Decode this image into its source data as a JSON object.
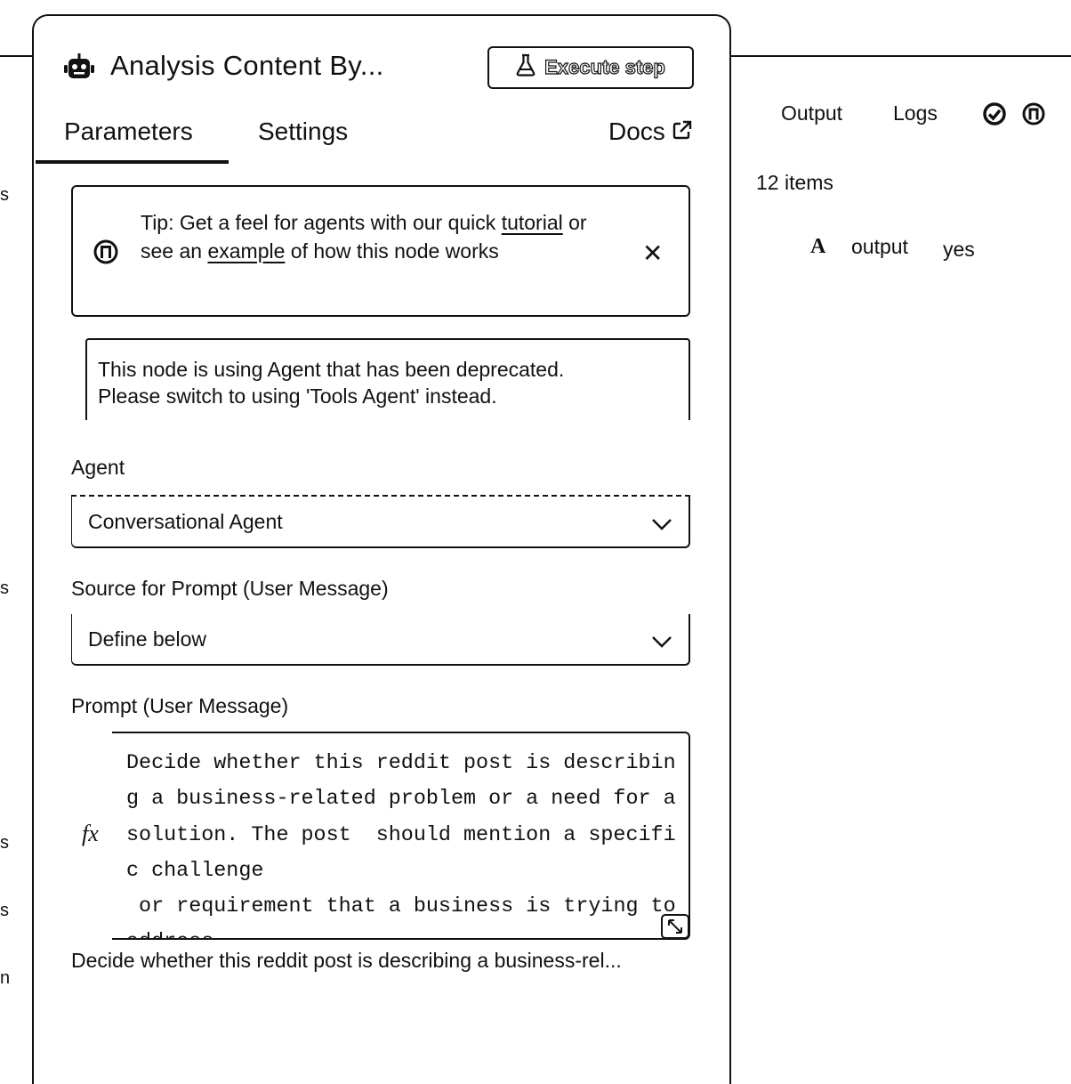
{
  "node": {
    "title": "Analysis Content  By...",
    "icon": "robot-icon",
    "execute_label": "Execute step"
  },
  "tabs": {
    "parameters": "Parameters",
    "settings": "Settings",
    "docs": "Docs"
  },
  "tip": {
    "prefix": "Tip: Get a feel for agents with our quick ",
    "link1": "tutorial",
    "middle": " or see an ",
    "link2": "example",
    "suffix": " of how this node works"
  },
  "warning": {
    "line1": "This node is using Agent that has been deprecated.",
    "line2": "Please switch to using 'Tools Agent' instead."
  },
  "fields": {
    "agent_label": "Agent",
    "agent_value": "Conversational Agent",
    "source_label": "Source for Prompt (User Message)",
    "source_value": "Define below",
    "prompt_label": "Prompt (User Message)",
    "prompt_fx": "fx",
    "prompt_value": "Decide whether this reddit post is describing a business-related problem or a need for a solution. The post  should mention a specific challenge\n or requirement that a business is trying to address",
    "prompt_preview": "Decide whether this reddit post is describing a business-rel..."
  },
  "output_panel": {
    "output_tab": "Output",
    "logs_tab": "Logs",
    "items_count": "12 items",
    "rows": [
      {
        "type": "A",
        "name": "output",
        "value": "yes"
      }
    ]
  },
  "left_edge": {
    "fragments": [
      "s",
      "s",
      "s",
      "s",
      "n"
    ]
  }
}
